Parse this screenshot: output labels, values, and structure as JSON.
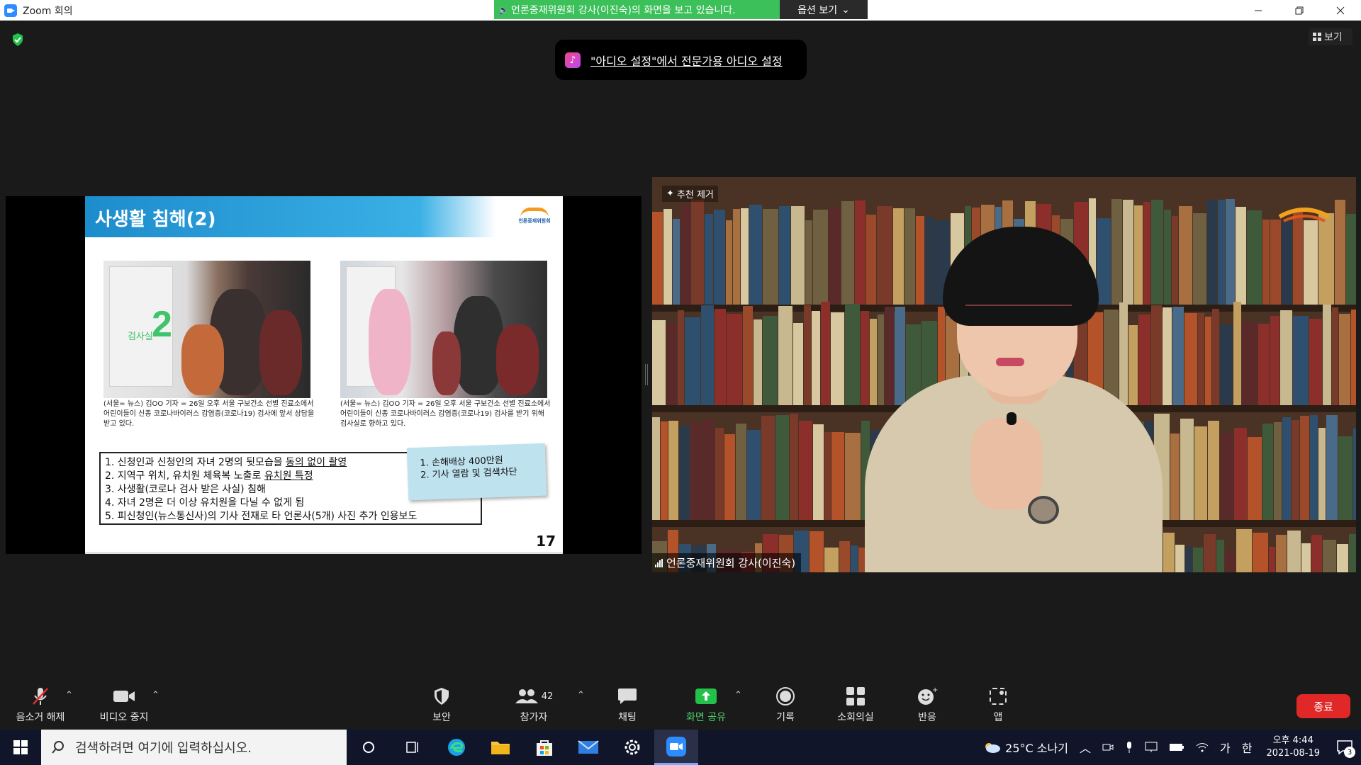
{
  "window": {
    "title": "Zoom 회의",
    "share_banner": "언론중재위원회 강사(이진숙)의 화면을 보고 있습니다.",
    "options_label": "옵션 보기",
    "view_label": "보기"
  },
  "toast": {
    "text": "\"아디오 설정\"에서 전문가용 아디오 설정"
  },
  "slide": {
    "title": "사생활 침해(2)",
    "logo_text": "언론중재위원회",
    "photo1_room_label": "검사실",
    "photo1_room_number": "2",
    "caption1": "(서울=    뉴스) 김OO 기자 = 26일 오후 서울    구보건소 선별 진료소에서 어린이들이 신종 코로나바이러스 감염증(코로나19) 검사에 앞서 상담을 받고 있다.",
    "caption2": "(서울=    뉴스) 김OO 기자 = 26일 오후 서울    구보건소 선별 진료소에서 어린이들이 신종 코로나바이러스 감염증(코로나19) 검사를 받기 위해 검사실로 향하고 있다.",
    "list": [
      {
        "pre": "1. 신청인과 신청인의 자녀 2명의 뒷모습을 ",
        "em": "동의 없이 촬영",
        "post": ""
      },
      {
        "pre": "2. 지역구 위치, 유치원 체육복 노출로 ",
        "em": "유치원 특정",
        "post": ""
      },
      {
        "pre": "3. 사생활(코로나 검사 받은 사실) 침해",
        "em": "",
        "post": ""
      },
      {
        "pre": "4. 자녀 2명은 더 이상 유치원을 다닐 수 없게 됨",
        "em": "",
        "post": ""
      },
      {
        "pre": "5. 피신청인(뉴스통신사)의 기사 전재로 타 언론사(5개) 사진 추가 인용보도",
        "em": "",
        "post": ""
      }
    ],
    "sticky": [
      "1. 손해배상 400만원",
      "2. 기사 열람 및 검색차단"
    ],
    "page_number": "17"
  },
  "video": {
    "spotlight_label": "추천 제거",
    "participant_name": "언론중재위원회 강사(이진숙)"
  },
  "toolbar": {
    "unmute": "음소거 해제",
    "video": "비디오 중지",
    "security": "보안",
    "participants": "참가자",
    "participants_count": "42",
    "chat": "채팅",
    "share": "화면 공유",
    "record": "기록",
    "breakout": "소회의실",
    "reactions": "반응",
    "apps": "앱",
    "end": "종료"
  },
  "taskbar": {
    "search_placeholder": "검색하려면 여기에 입력하십시오.",
    "weather": "25°C  소나기",
    "ime_lang": "가",
    "ime_mode": "한",
    "time": "오후 4:44",
    "date": "2021-08-19",
    "notifications": "3"
  },
  "colors": {
    "banner_green": "#3cc05a",
    "share_green": "#4dd26a",
    "end_red": "#e02828",
    "slide_blue": "#1d8ccc"
  }
}
